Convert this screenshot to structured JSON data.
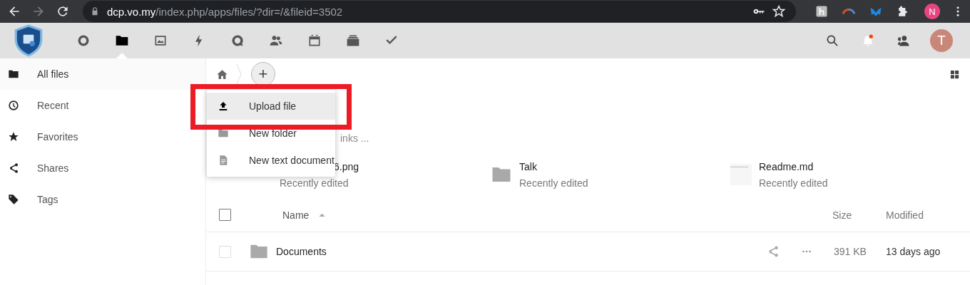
{
  "browser": {
    "url_host": "dcp.vo.my",
    "url_path": "/index.php/apps/files/?dir=/&fileid=3502",
    "profile_initial": "N"
  },
  "header": {
    "apps": [
      {
        "kind": "circle",
        "selected": false
      },
      {
        "kind": "folder",
        "selected": true
      },
      {
        "kind": "image",
        "selected": false
      },
      {
        "kind": "lightning",
        "selected": false
      },
      {
        "kind": "chat",
        "selected": false
      },
      {
        "kind": "people",
        "selected": false
      },
      {
        "kind": "calendar",
        "selected": false
      },
      {
        "kind": "stack",
        "selected": false
      },
      {
        "kind": "check",
        "selected": false
      }
    ],
    "notification_unread": true,
    "avatar_initial": "T"
  },
  "sidebar": {
    "items": [
      {
        "kind": "folder",
        "label": "All files",
        "selected": true
      },
      {
        "kind": "clock",
        "label": "Recent",
        "selected": false
      },
      {
        "kind": "star",
        "label": "Favorites",
        "selected": false
      },
      {
        "kind": "share",
        "label": "Shares",
        "selected": false
      },
      {
        "kind": "tag",
        "label": "Tags",
        "selected": false
      }
    ]
  },
  "breadcrumb": {
    "add_label": "+"
  },
  "new_menu": {
    "items": [
      {
        "kind": "upload",
        "label": "Upload file",
        "selected": true
      },
      {
        "kind": "folder",
        "label": "New folder",
        "selected": false
      },
      {
        "kind": "document",
        "label": "New text document",
        "selected": false
      }
    ]
  },
  "workspace_placeholder": "inks ...",
  "recent": [
    {
      "name": "6.png",
      "subtitle": "Recently edited"
    },
    {
      "kind": "folder",
      "name": "Talk",
      "subtitle": "Recently edited"
    },
    {
      "kind": "document",
      "name": "Readme.md",
      "subtitle": "Recently edited"
    }
  ],
  "table": {
    "select_all_checked": false,
    "columns": [
      {
        "label": "Name",
        "sorted": true
      },
      {
        "label": "Size",
        "sorted": false
      },
      {
        "label": "Modified",
        "sorted": false
      }
    ],
    "rows": [
      {
        "name": "Documents",
        "size": "391 KB",
        "modified": "13 days ago",
        "checked": false
      }
    ]
  }
}
